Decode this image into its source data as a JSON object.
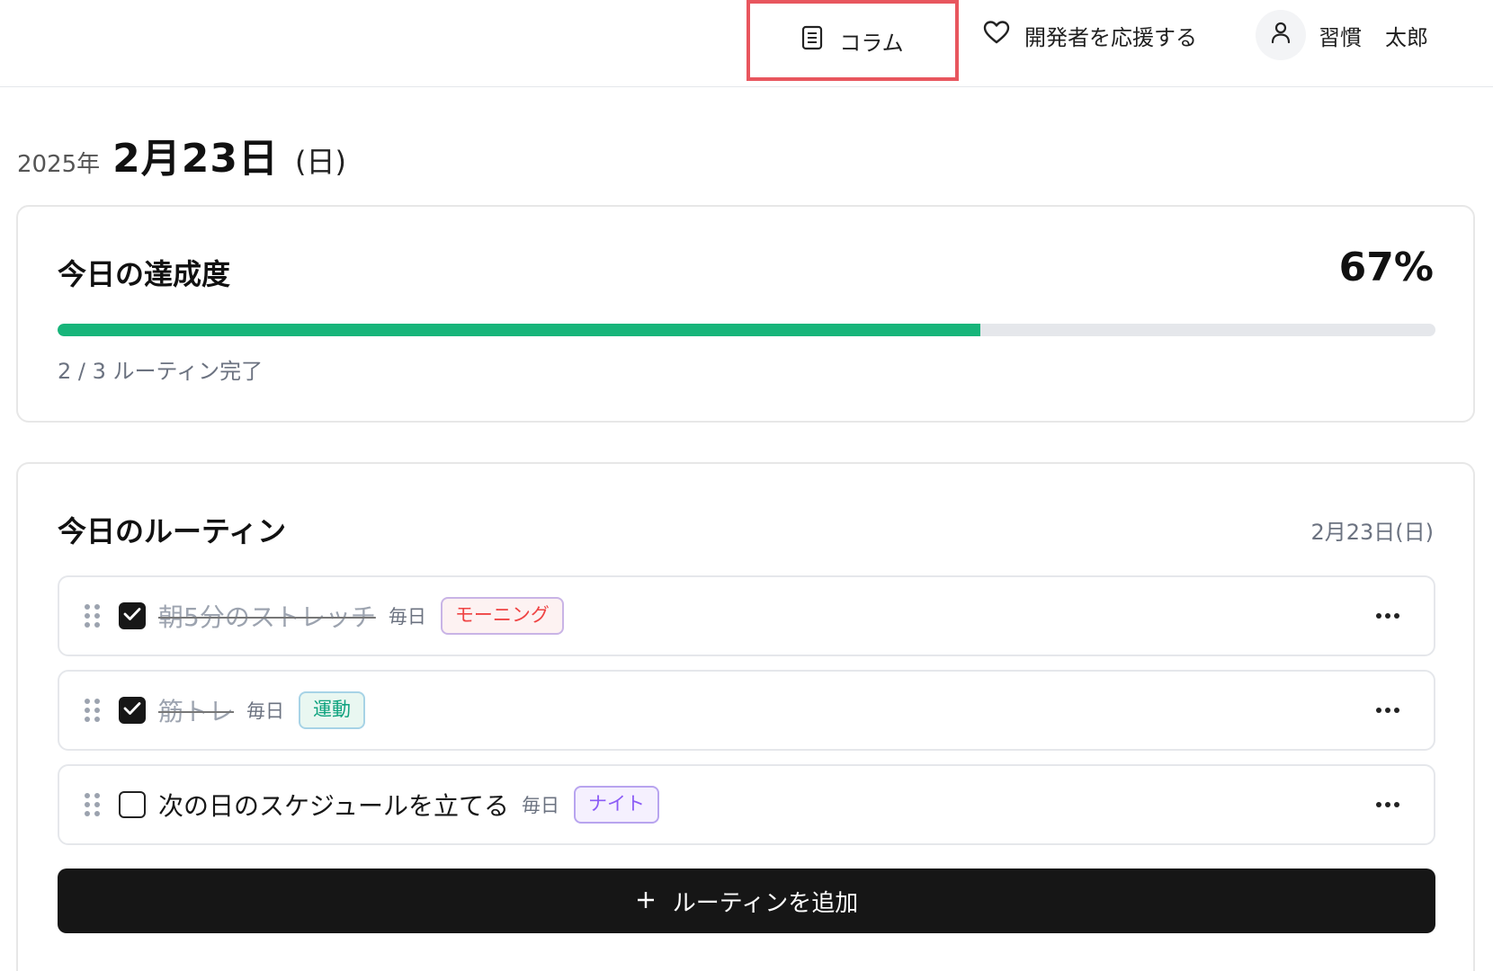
{
  "header": {
    "column_label": "コラム",
    "support_label": "開発者を応援する",
    "user": {
      "family_name": "習慣",
      "given_name": "太郎"
    }
  },
  "date_heading": {
    "year": "2025年",
    "date": "2月23日",
    "weekday": "(日)"
  },
  "progress_card": {
    "title": "今日の達成度",
    "percent_label": "67%",
    "percent_value": 0.67,
    "caption": "2 / 3 ルーティン完了",
    "accent_color": "#17b57a"
  },
  "routines_card": {
    "title": "今日のルーティン",
    "date_label": "2月23日(日)",
    "items": [
      {
        "name": "朝5分のストレッチ",
        "frequency": "毎日",
        "tag": "モーニング",
        "tag_type": "morning",
        "done": true
      },
      {
        "name": "筋トレ",
        "frequency": "毎日",
        "tag": "運動",
        "tag_type": "exercise",
        "done": true
      },
      {
        "name": "次の日のスケジュールを立てる",
        "frequency": "毎日",
        "tag": "ナイト",
        "tag_type": "night",
        "done": false
      }
    ],
    "add_button_label": "ルーティンを追加"
  },
  "icons": [
    "document-icon",
    "heart-icon",
    "user-icon",
    "drag-handle-icon",
    "check-icon",
    "more-icon",
    "plus-icon"
  ]
}
